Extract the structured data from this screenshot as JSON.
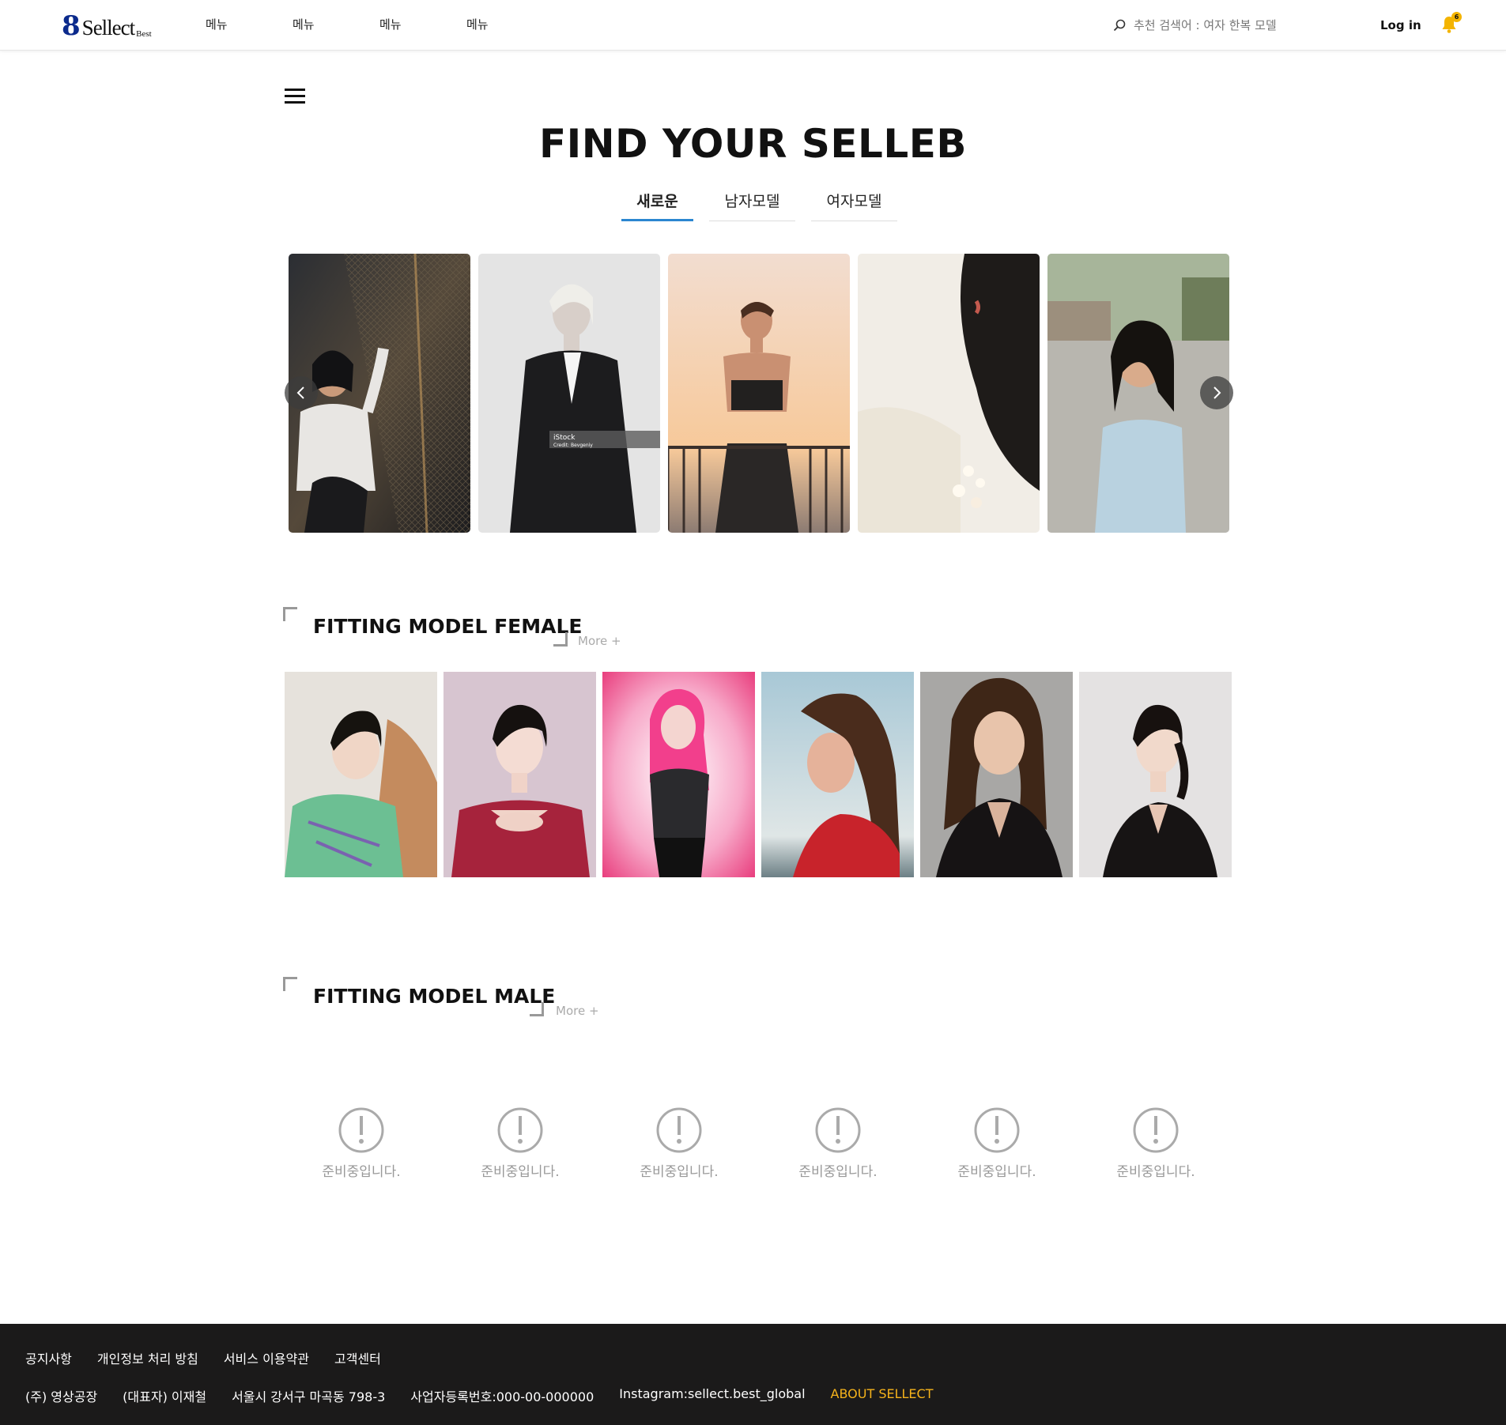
{
  "header": {
    "logo_mark": "8",
    "logo_text": "Sellect",
    "logo_sub": "Best",
    "nav": [
      "메뉴",
      "메뉴",
      "메뉴",
      "메뉴"
    ],
    "search_text": "추천 검색어 : 여자 한복 모델",
    "login_label": "Log in",
    "notification_count": "6"
  },
  "hero": {
    "title": "FIND YOUR SELLEB",
    "tabs": [
      "새로운",
      "남자모델",
      "여자모델"
    ],
    "active_tab": "새로운"
  },
  "carousel": {
    "slides": [
      {
        "photo": "woman in white blouse by metal grille at sunset"
      },
      {
        "photo": "blonde person in black suit, grey backdrop"
      },
      {
        "photo": "woman in black crop top on balcony at sunset"
      },
      {
        "photo": "close-up profile with dark hair and flowers"
      },
      {
        "photo": "woman with bob haircut on street"
      }
    ],
    "watermark_text": "iStock",
    "watermark_credit": "Credit: Bevgeniy"
  },
  "female_section": {
    "title": "FITTING MODEL FEMALE",
    "more_label": "More +",
    "cards": [
      {
        "photo": "model in green cardigan"
      },
      {
        "photo": "model in red top, mauve backdrop"
      },
      {
        "photo": "pink-haired model on pink backdrop"
      },
      {
        "photo": "model in red dress by the sea"
      },
      {
        "photo": "long brown hair model in black"
      },
      {
        "photo": "model in black sheer blouse"
      }
    ]
  },
  "male_section": {
    "title": "FITTING MODEL MALE",
    "more_label": "More +",
    "placeholders": [
      "준비중입니다.",
      "준비중입니다.",
      "준비중입니다.",
      "준비중입니다.",
      "준비중입니다.",
      "준비중입니다."
    ]
  },
  "footer": {
    "links": [
      "공지사항",
      "개인정보 처리 방침",
      "서비스 이용약관",
      "고객센터"
    ],
    "company": "(주) 영상공장",
    "ceo": "(대표자) 이재철",
    "address": "서울시 강서구 마곡동 798-3",
    "business_no": "사업자등록번호:000-00-000000",
    "instagram": "Instagram:sellect.best_global",
    "about": "ABOUT SELLECT"
  },
  "colors": {
    "accent_blue": "#2b86d0",
    "footer_bg": "#1b1a1a",
    "footer_accent": "#f6b31b",
    "bell": "#f4b400",
    "logo_blue": "#0b2a8c"
  }
}
